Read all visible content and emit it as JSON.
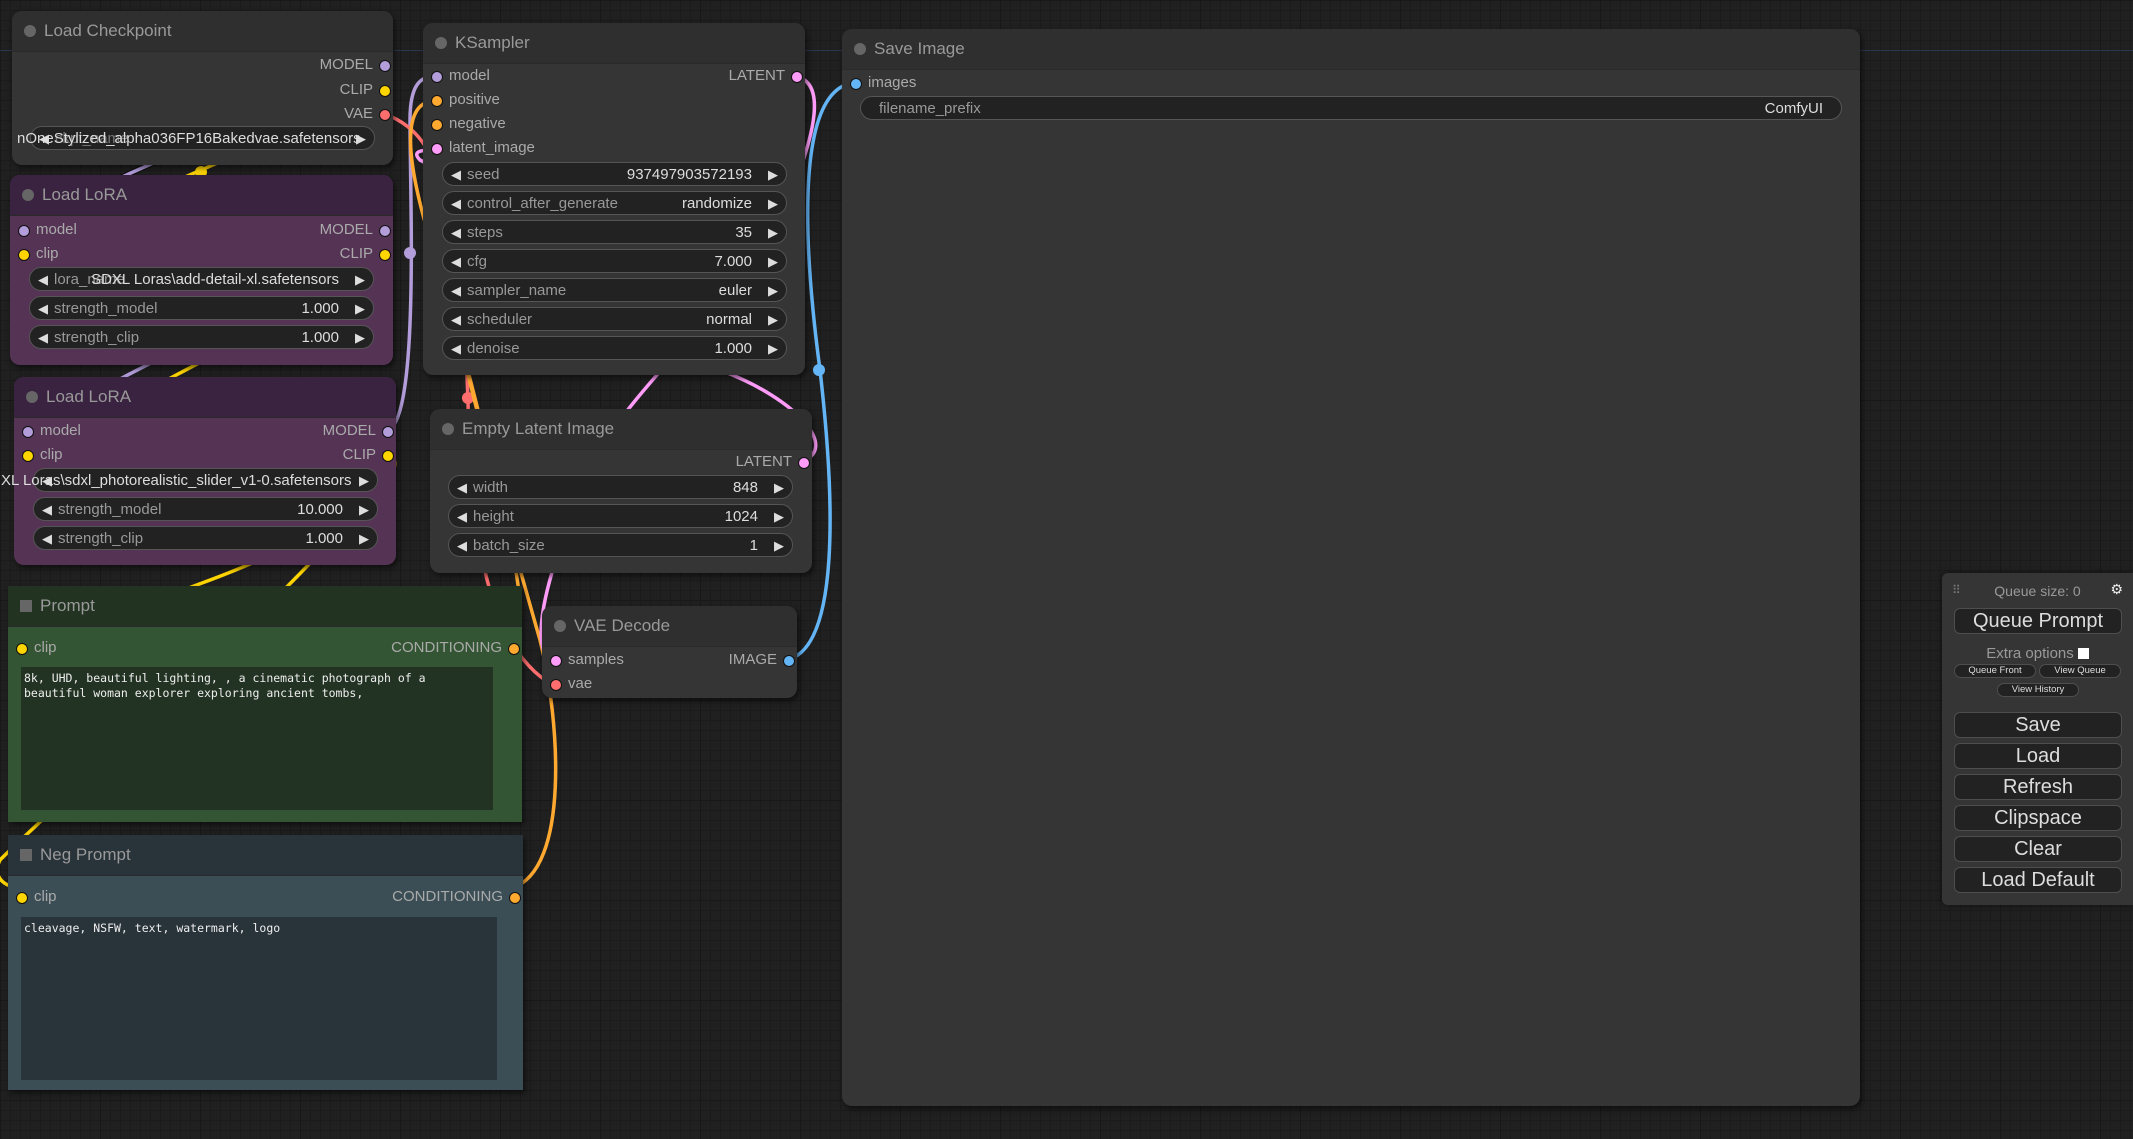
{
  "colors": {
    "model": "#b39ddb",
    "clip": "#ffd500",
    "vae": "#ff6e6e",
    "conditioning": "#ffa931",
    "latent": "#ff9cf9",
    "image": "#64b5f6",
    "lora_node": "#553355",
    "prompt_node": "#335533",
    "neg_node": "#3b4e55"
  },
  "nodes": {
    "load_checkpoint": {
      "title": "Load Checkpoint",
      "outputs": [
        "MODEL",
        "CLIP",
        "VAE"
      ],
      "ckpt_name_overflow": "nOneStylized_alpha036FP16Bakedvae.safetensors",
      "ckpt_name_label": "ckpt_name",
      "ckpt_name": "Stylized_alpha036FP16Bakedvae.safetensors"
    },
    "load_lora_1": {
      "title": "Load LoRA",
      "inputs": [
        "model",
        "clip"
      ],
      "outputs": [
        "MODEL",
        "CLIP"
      ],
      "lora_name_label": "lora_name",
      "lora_name": "SDXL Loras\\add-detail-xl.safetensors",
      "strength_model_label": "strength_model",
      "strength_model": "1.000",
      "strength_clip_label": "strength_clip",
      "strength_clip": "1.000"
    },
    "load_lora_2": {
      "title": "Load LoRA",
      "inputs": [
        "model",
        "clip"
      ],
      "outputs": [
        "MODEL",
        "CLIP"
      ],
      "lora_name_overflow": "XL Loras\\sdxl_photorealistic_slider_v1-0.safetensors",
      "lora_name": "sdxl_photorealistic_slider_v1-0.safetensors",
      "strength_model_label": "strength_model",
      "strength_model": "10.000",
      "strength_clip_label": "strength_clip",
      "strength_clip": "1.000"
    },
    "prompt": {
      "title": "Prompt",
      "input": "clip",
      "output": "CONDITIONING",
      "text": "8k, UHD, beautiful lighting, , a cinematic photograph of a beautiful woman explorer exploring ancient tombs,"
    },
    "neg_prompt": {
      "title": "Neg Prompt",
      "input": "clip",
      "output": "CONDITIONING",
      "text": "cleavage, NSFW, text, watermark, logo"
    },
    "ksampler": {
      "title": "KSampler",
      "inputs": [
        "model",
        "positive",
        "negative",
        "latent_image"
      ],
      "output": "LATENT",
      "widgets": [
        {
          "label": "seed",
          "value": "937497903572193"
        },
        {
          "label": "control_after_generate",
          "value": "randomize"
        },
        {
          "label": "steps",
          "value": "35"
        },
        {
          "label": "cfg",
          "value": "7.000"
        },
        {
          "label": "sampler_name",
          "value": "euler"
        },
        {
          "label": "scheduler",
          "value": "normal"
        },
        {
          "label": "denoise",
          "value": "1.000"
        }
      ]
    },
    "empty_latent": {
      "title": "Empty Latent Image",
      "output": "LATENT",
      "widgets": [
        {
          "label": "width",
          "value": "848"
        },
        {
          "label": "height",
          "value": "1024"
        },
        {
          "label": "batch_size",
          "value": "1"
        }
      ]
    },
    "vae_decode": {
      "title": "VAE Decode",
      "inputs": [
        "samples",
        "vae"
      ],
      "output": "IMAGE"
    },
    "save_image": {
      "title": "Save Image",
      "input": "images",
      "filename_prefix_label": "filename_prefix",
      "filename_prefix": "ComfyUI"
    }
  },
  "panel": {
    "queue_size": "Queue size: 0",
    "queue_prompt": "Queue Prompt",
    "extra_options": "Extra options",
    "extra_options_checked": false,
    "queue_front": "Queue Front",
    "view_queue": "View Queue",
    "view_history": "View History",
    "buttons": [
      "Save",
      "Load",
      "Refresh",
      "Clipspace",
      "Clear",
      "Load Default"
    ]
  }
}
